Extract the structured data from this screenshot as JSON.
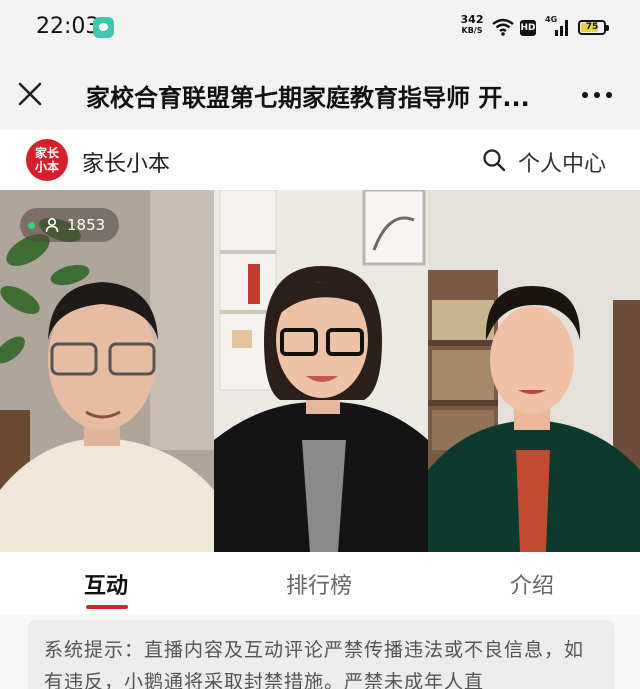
{
  "status_bar": {
    "time": "22:03",
    "net_speed_value": "342",
    "net_speed_unit": "KB/S",
    "hd_label": "HD",
    "signal_label": "4G",
    "battery_level": "75",
    "battery_fraction": 0.75,
    "battery_color": "#e5d14a"
  },
  "header": {
    "close_icon": "close-icon",
    "title": "家校合育联盟第七期家庭教育指导师 开...",
    "more_icon": "more-icon"
  },
  "channel": {
    "logo_text": "家长小本",
    "name": "家长小本",
    "search_icon": "search-icon",
    "personal_center": "个人中心",
    "brand_color": "#d71f2a"
  },
  "live": {
    "viewer_icon": "person-icon",
    "viewer_count": "1853",
    "live_dot_color": "#36d27a"
  },
  "tabs": [
    {
      "label": "互动",
      "active": true
    },
    {
      "label": "排行榜",
      "active": false
    },
    {
      "label": "介绍",
      "active": false
    }
  ],
  "accent_color": "#d8232a",
  "notice": {
    "text": "系统提示：直播内容及互动评论严禁传播违法或不良信息，如有违反，小鹅通将采取封禁措施。严禁未成年人直"
  }
}
